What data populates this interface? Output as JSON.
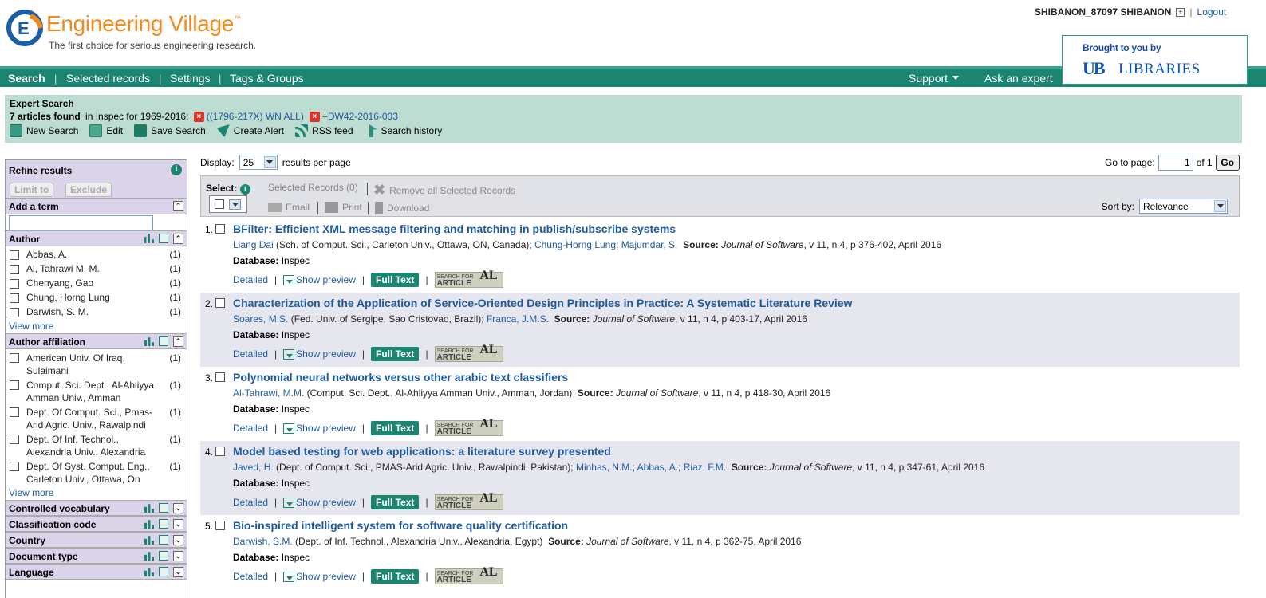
{
  "header": {
    "logo_name": "Engineering Village",
    "logo_tm": "™",
    "tagline": "The first choice for serious engineering research.",
    "user": "SHIBANON_87097 SHIBANON",
    "logout": "Logout",
    "brought_by": "Brought to you by",
    "ub": "UB",
    "libraries": "LIBRARIES"
  },
  "nav": {
    "search": "Search",
    "selected": "Selected records",
    "settings": "Settings",
    "tags": "Tags & Groups",
    "support": "Support",
    "expert": "Ask an expert"
  },
  "search_summary": {
    "type": "Expert Search",
    "count": "7 articles found",
    "scope": " in Inspec for 1969-2016: ",
    "term1": "((1796-217X) WN ALL)",
    "term2_prefix": "+",
    "term2": "DW42-2016-003",
    "actions": {
      "new_search": "New Search",
      "edit": "Edit",
      "save_search": "Save Search",
      "create_alert": "Create Alert",
      "rss": "RSS feed",
      "history": "Search history"
    }
  },
  "sidebar": {
    "refine": "Refine results",
    "limit": "Limit to",
    "exclude": "Exclude",
    "add_term": "Add a term",
    "author": {
      "title": "Author",
      "items": [
        {
          "label": "Abbas, A.",
          "count": "(1)"
        },
        {
          "label": "Al, Tahrawi M. M.",
          "count": "(1)"
        },
        {
          "label": "Chenyang, Gao",
          "count": "(1)"
        },
        {
          "label": "Chung, Horng Lung",
          "count": "(1)"
        },
        {
          "label": "Darwish, S. M.",
          "count": "(1)"
        }
      ],
      "more": "View more"
    },
    "affiliation": {
      "title": "Author affiliation",
      "items": [
        {
          "label": "American Univ. Of Iraq, Sulaimani",
          "count": "(1)"
        },
        {
          "label": "Comput. Sci. Dept., Al-Ahliyya Amman Univ., Amman",
          "count": "(1)"
        },
        {
          "label": "Dept. Of Comput. Sci., Pmas-Arid Agric. Univ., Rawalpindi",
          "count": "(1)"
        },
        {
          "label": "Dept. Of Inf. Technol., Alexandria Univ., Alexandria",
          "count": "(1)"
        },
        {
          "label": "Dept. Of Syst. Comput. Eng., Carleton Univ., Ottawa, On",
          "count": "(1)"
        }
      ],
      "more": "View more"
    },
    "collapsed": [
      "Controlled vocabulary",
      "Classification code",
      "Country",
      "Document type",
      "Language"
    ]
  },
  "results_controls": {
    "display_label": "Display:",
    "per_page_value": "25",
    "per_page_suffix": "results per page",
    "goto_label": "Go to page:",
    "page": "1",
    "of": "of 1",
    "go": "Go",
    "select_label": "Select:",
    "selected_records": "Selected Records (0)",
    "remove_all": "Remove all Selected Records",
    "email": "Email",
    "print": "Print",
    "download": "Download",
    "sort_label": "Sort by:",
    "sort_value": "Relevance"
  },
  "result_labels": {
    "source": "Source:",
    "database": "Database:",
    "detailed": "Detailed",
    "preview": "Show preview",
    "full_text": "Full Text",
    "sfa_line1": "SEARCH FOR",
    "sfa_line2": "ARTICLE",
    "sfa_logo": "AL"
  },
  "results": [
    {
      "num": "1.",
      "title": "BFilter: Efficient XML message filtering and matching in publish/subscribe systems",
      "authors": [
        {
          "name": "Liang Dai",
          "aff": " (Sch. of Comput. Sci., Carleton Univ., Ottawa, ON, Canada); "
        },
        {
          "name": "Chung-Horng Lung",
          "aff": "; "
        },
        {
          "name": "Majumdar, S.",
          "aff": "  "
        }
      ],
      "journal": "Journal of Software",
      "details": ", v 11, n 4, p 376-402, April 2016",
      "db": "Inspec"
    },
    {
      "num": "2.",
      "title": "Characterization of the Application of Service-Oriented Design Principles in Practice: A Systematic Literature Review",
      "authors": [
        {
          "name": "Soares, M.S.",
          "aff": " (Fed. Univ. of Sergipe, Sao Cristovao, Brazil); "
        },
        {
          "name": "Franca, J.M.S.",
          "aff": "  "
        }
      ],
      "journal": "Journal of Software",
      "details": ", v 11, n 4, p 403-17, April 2016",
      "db": "Inspec"
    },
    {
      "num": "3.",
      "title": "Polynomial neural networks versus other arabic text classifiers",
      "authors": [
        {
          "name": "Al-Tahrawi, M.M.",
          "aff": " (Comput. Sci. Dept., Al-Ahliyya Amman Univ., Amman, Jordan)  "
        }
      ],
      "journal": "Journal of Software",
      "details": ", v 11, n 4, p 418-30, April 2016",
      "db": "Inspec"
    },
    {
      "num": "4.",
      "title": "Model based testing for web applications: a literature survey presented",
      "authors": [
        {
          "name": "Javed, H.",
          "aff": " (Dept. of Comput. Sci., PMAS-Arid Agric. Univ., Rawalpindi, Pakistan); "
        },
        {
          "name": "Minhas, N.M.",
          "aff": "; "
        },
        {
          "name": "Abbas, A.",
          "aff": "; "
        },
        {
          "name": "Riaz, F.M.",
          "aff": "  "
        }
      ],
      "journal": "Journal of Software",
      "details": ", v 11, n 4, p 347-61, April 2016",
      "db": "Inspec"
    },
    {
      "num": "5.",
      "title": "Bio-inspired intelligent system for software quality certification",
      "authors": [
        {
          "name": "Darwish, S.M.",
          "aff": " (Dept. of Inf. Technol., Alexandria Univ., Alexandria, Egypt)  "
        }
      ],
      "journal": "Journal of Software",
      "details": ", v 11, n 4, p 362-75, April 2016",
      "db": "Inspec"
    }
  ],
  "colors": {
    "brand_orange": "#f08a1c",
    "nav_green": "#1a8570",
    "link_blue": "#1f5a9e"
  }
}
